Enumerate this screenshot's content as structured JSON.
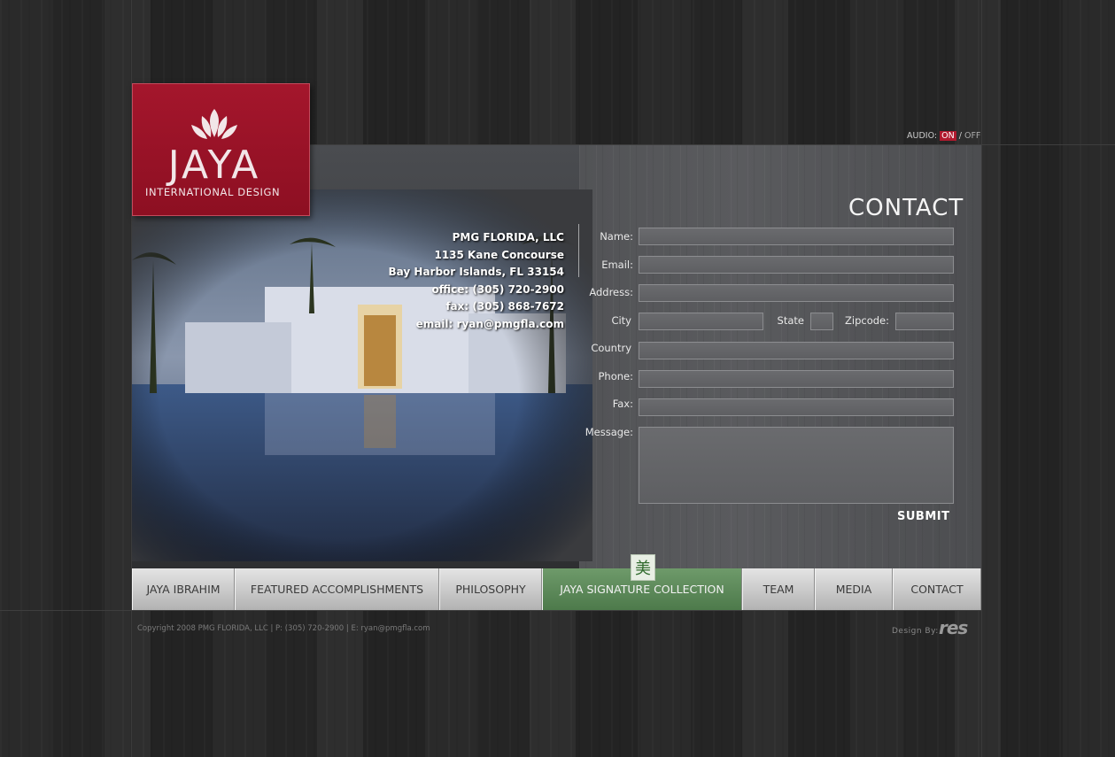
{
  "logo": {
    "name": "JAYA",
    "tagline": "INTERNATIONAL DESIGN"
  },
  "audio": {
    "label": "AUDIO:",
    "on": "ON",
    "separator": "/",
    "off": "OFF"
  },
  "page_title": "CONTACT",
  "address": {
    "company": "PMG FLORIDA, LLC",
    "street": "1135 Kane Concourse",
    "city_line": "Bay Harbor Islands, FL 33154",
    "office": "office: (305) 720-2900",
    "fax": "fax: (305) 868-7672",
    "email": "email: ryan@pmgfla.com"
  },
  "form": {
    "name_label": "Name:",
    "email_label": "Email:",
    "address_label": "Address:",
    "city_label": "City",
    "state_label": "State",
    "zip_label": "Zipcode:",
    "country_label": "Country",
    "phone_label": "Phone:",
    "fax_label": "Fax:",
    "message_label": "Message:",
    "submit_label": "SUBMIT"
  },
  "nav": {
    "items": [
      {
        "label": "JAYA IBRAHIM"
      },
      {
        "label": "FEATURED ACCOMPLISHMENTS"
      },
      {
        "label": "PHILOSOPHY"
      },
      {
        "label": "JAYA SIGNATURE COLLECTION"
      },
      {
        "label": "TEAM"
      },
      {
        "label": "MEDIA"
      },
      {
        "label": "CONTACT"
      }
    ],
    "active_index": 3,
    "badge_glyph": "美"
  },
  "footer": {
    "copyright": "Copyright 2008 PMG FLORIDA, LLC | P: (305) 720-2900 | E: ryan@pmgfla.com",
    "credit_label": "Design By:",
    "credit_logo": "res"
  },
  "colors": {
    "brand_red": "#9b1428",
    "active_nav_green": "#5a8756",
    "background": "#2a2a2a"
  }
}
